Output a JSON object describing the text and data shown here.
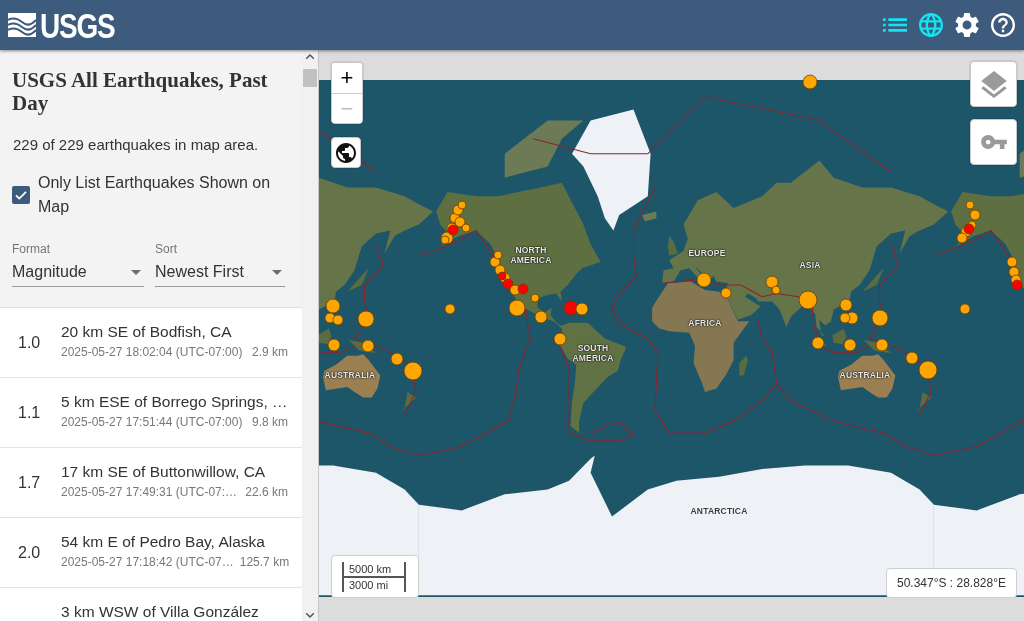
{
  "header": {
    "logo": "USGS",
    "icons": [
      {
        "kind": "list",
        "selected": true
      },
      {
        "kind": "map",
        "selected": true
      },
      {
        "kind": "settings",
        "selected": false
      },
      {
        "kind": "help",
        "selected": false
      }
    ]
  },
  "sidebar": {
    "title": "USGS All Earthquakes, Past Day",
    "count": "229 of 229 earthquakes in map area.",
    "filter": {
      "label": "Only List Earthquakes Shown on Map",
      "checked": true
    },
    "selects": [
      {
        "label": "Format",
        "value": "Magnitude"
      },
      {
        "label": "Sort",
        "value": "Newest First"
      }
    ],
    "earthquakes": [
      {
        "magnitude": "1.0",
        "place": "20 km SE of Bodfish, CA",
        "time": "2025-05-27 18:02:04 (UTC-07:00)",
        "depth": "2.9 km"
      },
      {
        "magnitude": "1.1",
        "place": "5 km ESE of Borrego Springs, …",
        "time": "2025-05-27 17:51:44 (UTC-07:00)",
        "depth": "9.8 km"
      },
      {
        "magnitude": "1.7",
        "place": "17 km SE of Buttonwillow, CA",
        "time": "2025-05-27 17:49:31 (UTC-07:…",
        "depth": "22.6 km"
      },
      {
        "magnitude": "2.0",
        "place": "54 km E of Pedro Bay, Alaska",
        "time": "2025-05-27 17:18:42 (UTC-07…",
        "depth": "125.7 km"
      },
      {
        "place": "3 km WSW of Villa González"
      }
    ]
  },
  "map": {
    "zoom": [
      {
        "label": "+",
        "disabled": false
      },
      {
        "label": "−",
        "disabled": true
      }
    ],
    "labels": [
      "NORTH AMERICA",
      "EUROPE",
      "ASIA",
      "AFRICA",
      "SOUTH AMERICA",
      "AUSTRALIA",
      "AUSTRALIA",
      "ANTARCTICA"
    ],
    "markers": [
      {
        "color": "#ffa500"
      },
      {
        "color": "#ffa500"
      },
      {
        "color": "#ffa500"
      },
      {
        "color": "#ffa500"
      },
      {
        "color": "#ffa500"
      },
      {
        "color": "#ffa500"
      },
      {
        "color": "#ffa500"
      },
      {
        "color": "#ffa500"
      },
      {
        "color": "#ff0000"
      },
      {
        "color": "#ffa500"
      },
      {
        "color": "#ffa500"
      },
      {
        "color": "#ffa500"
      },
      {
        "color": "#ffa500"
      },
      {
        "color": "#ffa500"
      },
      {
        "color": "#ff0000"
      },
      {
        "color": "#ff0000"
      },
      {
        "color": "#ffa500"
      },
      {
        "color": "#ff0000"
      },
      {
        "color": "#ffa500"
      },
      {
        "color": "#ffa500"
      },
      {
        "color": "#ffa500"
      },
      {
        "color": "#ff0000"
      },
      {
        "color": "#ffa500"
      },
      {
        "color": "#ffa500"
      },
      {
        "color": "#ffa500"
      },
      {
        "color": "#ffa500"
      },
      {
        "color": "#ffa500"
      },
      {
        "color": "#ffa500"
      },
      {
        "color": "#ffa500"
      },
      {
        "color": "#ffa500"
      },
      {
        "color": "#ffa500"
      },
      {
        "color": "#ffa500"
      },
      {
        "color": "#ffa500"
      },
      {
        "color": "#ffa500"
      },
      {
        "color": "#ffa500"
      },
      {
        "color": "#ffa500"
      },
      {
        "color": "#ffa500"
      },
      {
        "color": "#ffa500"
      },
      {
        "color": "#ffa500"
      },
      {
        "color": "#ffa500"
      },
      {
        "color": "#ffa500"
      },
      {
        "color": "#ffa500"
      },
      {
        "color": "#ffa500"
      },
      {
        "color": "#ffa500"
      },
      {
        "color": "#ffa500"
      },
      {
        "color": "#ffa500"
      },
      {
        "color": "#ffa500"
      },
      {
        "color": "#ffa500"
      },
      {
        "color": "#ffa500"
      },
      {
        "color": "#ffa500"
      },
      {
        "color": "#ffa500"
      },
      {
        "color": "#ffa500"
      },
      {
        "color": "#ffa500"
      },
      {
        "color": "#ff0000"
      },
      {
        "color": "#ffa500"
      },
      {
        "color": "#ffa500"
      },
      {
        "color": "#ffa500"
      },
      {
        "color": "#ff0000"
      }
    ],
    "scale": [
      "5000 km",
      "3000 mi"
    ],
    "coordinates": "50.347°S : 28.828°E"
  }
}
